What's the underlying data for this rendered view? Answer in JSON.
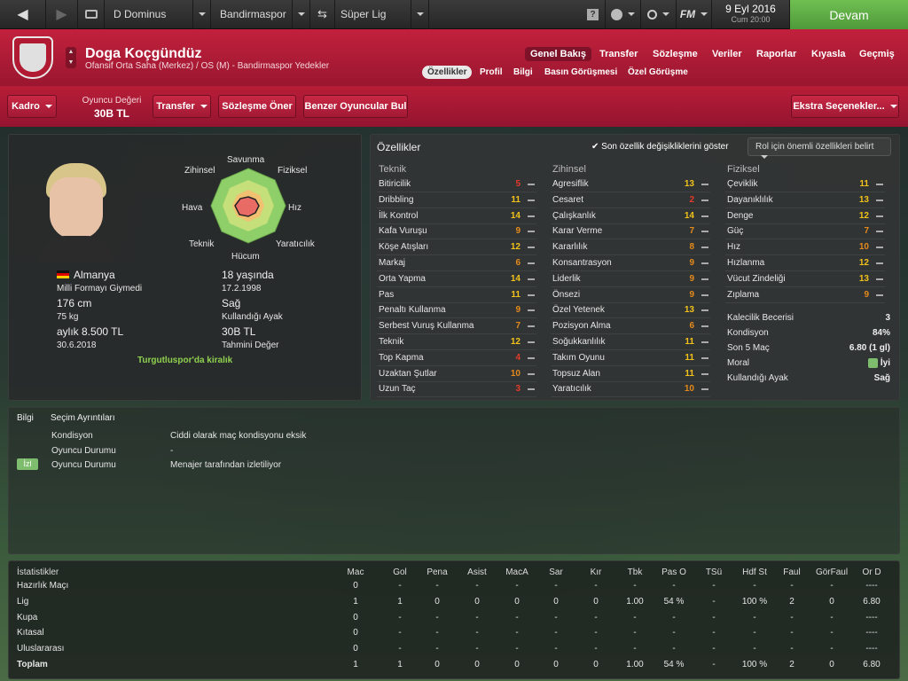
{
  "topbar": {
    "manager": "D Dominus",
    "club": "Bandirmaspor",
    "league": "Süper Lig",
    "fm": "FM",
    "date": "9 Eyl 2016",
    "time": "Cum 20:00",
    "continue": "Devam"
  },
  "header": {
    "name": "Doga Koçgündüz",
    "subtitle": "Ofansif Orta Saha (Merkez) / OS (M) - Bandirmaspor Yedekler",
    "nav": [
      "Genel Bakış",
      "Transfer",
      "Sözleşme",
      "Veriler",
      "Raporlar",
      "Kıyasla",
      "Geçmiş"
    ],
    "subnav": [
      "Özellikler",
      "Profil",
      "Bilgi",
      "Basın Görüşmesi",
      "Özel Görüşme"
    ]
  },
  "toolbar": {
    "squad": "Kadro",
    "value_label": "Oyuncu Değeri",
    "value": "30B TL",
    "transfer": "Transfer",
    "offer": "Sözleşme Öner",
    "similar": "Benzer Oyuncular Bul",
    "extra": "Ekstra Seçenekler..."
  },
  "profile": {
    "nation": "Almanya",
    "age": "18 yaşında",
    "caps": "Milli Formayı Giymedi",
    "dob": "17.2.1998",
    "height": "176 cm",
    "foot": "Sağ",
    "weight": "75 kg",
    "foot_label": "Kullandığı Ayak",
    "wage": "aylık 8.500 TL",
    "value": "30B TL",
    "contract": "30.6.2018",
    "value_label": "Tahmini Değer",
    "loan": "Turgutluspor'da kiralık",
    "radar": [
      "Savunma",
      "Fiziksel",
      "Hız",
      "Yaratıcılık",
      "Hücum",
      "Teknik",
      "Hava",
      "Zihinsel"
    ]
  },
  "attributes": {
    "title": "Özellikler",
    "show_changes": "Son özellik değişikliklerini göster",
    "role": "Rol için önemli özellikleri belirt",
    "technical_title": "Teknik",
    "mental_title": "Zihinsel",
    "physical_title": "Fiziksel",
    "technical": [
      {
        "n": "Bitiricilik",
        "v": "5"
      },
      {
        "n": "Dribbling",
        "v": "11"
      },
      {
        "n": "İlk Kontrol",
        "v": "14"
      },
      {
        "n": "Kafa Vuruşu",
        "v": "9"
      },
      {
        "n": "Köşe Atışları",
        "v": "12"
      },
      {
        "n": "Markaj",
        "v": "6"
      },
      {
        "n": "Orta Yapma",
        "v": "14"
      },
      {
        "n": "Pas",
        "v": "11"
      },
      {
        "n": "Penaltı Kullanma",
        "v": "9"
      },
      {
        "n": "Serbest Vuruş Kullanma",
        "v": "7"
      },
      {
        "n": "Teknik",
        "v": "12"
      },
      {
        "n": "Top Kapma",
        "v": "4"
      },
      {
        "n": "Uzaktan Şutlar",
        "v": "10"
      },
      {
        "n": "Uzun Taç",
        "v": "3"
      }
    ],
    "mental": [
      {
        "n": "Agresiflik",
        "v": "13"
      },
      {
        "n": "Cesaret",
        "v": "2"
      },
      {
        "n": "Çalışkanlık",
        "v": "14"
      },
      {
        "n": "Karar Verme",
        "v": "7"
      },
      {
        "n": "Kararlılık",
        "v": "8"
      },
      {
        "n": "Konsantrasyon",
        "v": "9"
      },
      {
        "n": "Liderlik",
        "v": "9"
      },
      {
        "n": "Önsezi",
        "v": "9"
      },
      {
        "n": "Özel Yetenek",
        "v": "13"
      },
      {
        "n": "Pozisyon Alma",
        "v": "6"
      },
      {
        "n": "Soğukkanlılık",
        "v": "11"
      },
      {
        "n": "Takım Oyunu",
        "v": "11"
      },
      {
        "n": "Topsuz Alan",
        "v": "11"
      },
      {
        "n": "Yaratıcılık",
        "v": "10"
      }
    ],
    "physical": [
      {
        "n": "Çeviklik",
        "v": "11"
      },
      {
        "n": "Dayanıklılık",
        "v": "13"
      },
      {
        "n": "Denge",
        "v": "12"
      },
      {
        "n": "Güç",
        "v": "7"
      },
      {
        "n": "Hız",
        "v": "10"
      },
      {
        "n": "Hızlanma",
        "v": "12"
      },
      {
        "n": "Vücut Zindeliği",
        "v": "13"
      },
      {
        "n": "Zıplama",
        "v": "9"
      }
    ],
    "extra": [
      {
        "n": "Kalecilik Becerisi",
        "v": "3"
      },
      {
        "n": "Kondisyon",
        "v": "84%"
      },
      {
        "n": "Son 5 Maç",
        "v": "6.80 (1 gl)"
      },
      {
        "n": "Moral",
        "v": "İyi"
      },
      {
        "n": "Kullandığı Ayak",
        "v": "Sağ"
      }
    ]
  },
  "info": {
    "tab1": "Bilgi",
    "tab2": "Seçim Ayrıntıları",
    "badge": "İzl",
    "rows": [
      {
        "k": "Kondisyon",
        "v": "Ciddi olarak maç kondisyonu eksik"
      },
      {
        "k": "Oyuncu Durumu",
        "v": "-"
      },
      {
        "k": "Oyuncu Durumu",
        "v": "Menajer tarafından izletiliyor"
      }
    ]
  },
  "stats": {
    "title": "İstatistikler",
    "headers": [
      "Mac",
      "Gol",
      "Pena",
      "Asist",
      "MacA",
      "Sar",
      "Kır",
      "Tbk",
      "Pas O",
      "TSü",
      "Hdf St",
      "Faul",
      "GörFaul",
      "Or D"
    ],
    "rows": [
      {
        "name": "Hazırlık Maçı",
        "vals": [
          "0",
          "-",
          "-",
          "-",
          "-",
          "-",
          "-",
          "-",
          "-",
          "-",
          "-",
          "-",
          "-",
          "----"
        ]
      },
      {
        "name": "Lig",
        "vals": [
          "1",
          "1",
          "0",
          "0",
          "0",
          "0",
          "0",
          "1.00",
          "54 %",
          "-",
          "100 %",
          "2",
          "0",
          "6.80"
        ]
      },
      {
        "name": "Kupa",
        "vals": [
          "0",
          "-",
          "-",
          "-",
          "-",
          "-",
          "-",
          "-",
          "-",
          "-",
          "-",
          "-",
          "-",
          "----"
        ]
      },
      {
        "name": "Kıtasal",
        "vals": [
          "0",
          "-",
          "-",
          "-",
          "-",
          "-",
          "-",
          "-",
          "-",
          "-",
          "-",
          "-",
          "-",
          "----"
        ]
      },
      {
        "name": "Uluslararası",
        "vals": [
          "0",
          "-",
          "-",
          "-",
          "-",
          "-",
          "-",
          "-",
          "-",
          "-",
          "-",
          "-",
          "-",
          "----"
        ]
      },
      {
        "name": "Toplam",
        "vals": [
          "1",
          "1",
          "0",
          "0",
          "0",
          "0",
          "0",
          "1.00",
          "54 %",
          "-",
          "100 %",
          "2",
          "0",
          "6.80"
        ]
      }
    ]
  }
}
